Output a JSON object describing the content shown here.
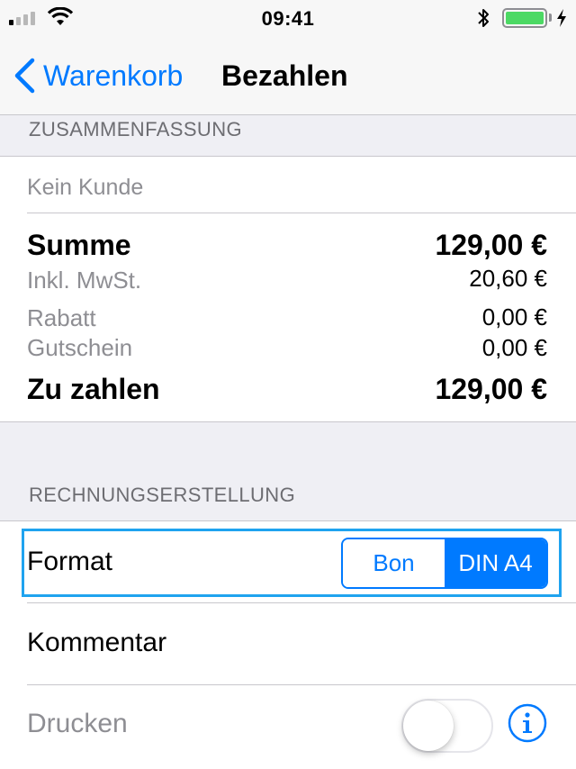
{
  "status_bar": {
    "time": "09:41",
    "signal_bars_active": 1,
    "battery_level": 1.0
  },
  "nav": {
    "back_label": "Warenkorb",
    "title": "Bezahlen"
  },
  "summary": {
    "header": "ZUSAMMENFASSUNG",
    "customer": "Kein Kunde",
    "sum_label": "Summe",
    "sum_value": "129,00 €",
    "vat_label": "Inkl. MwSt.",
    "vat_value": "20,60 €",
    "discount_label": "Rabatt",
    "discount_value": "0,00 €",
    "voucher_label": "Gutschein",
    "voucher_value": "0,00 €",
    "due_label": "Zu zahlen",
    "due_value": "129,00 €"
  },
  "invoice": {
    "header": "RECHNUNGSERSTELLUNG",
    "format_label": "Format",
    "format_options": [
      "Bon",
      "DIN A4"
    ],
    "format_selected": "DIN A4",
    "comment_label": "Kommentar",
    "print_label": "Drucken",
    "print_enabled": false
  },
  "colors": {
    "accent": "#007aff",
    "highlight": "#1fa3ef",
    "battery": "#4cd964"
  }
}
